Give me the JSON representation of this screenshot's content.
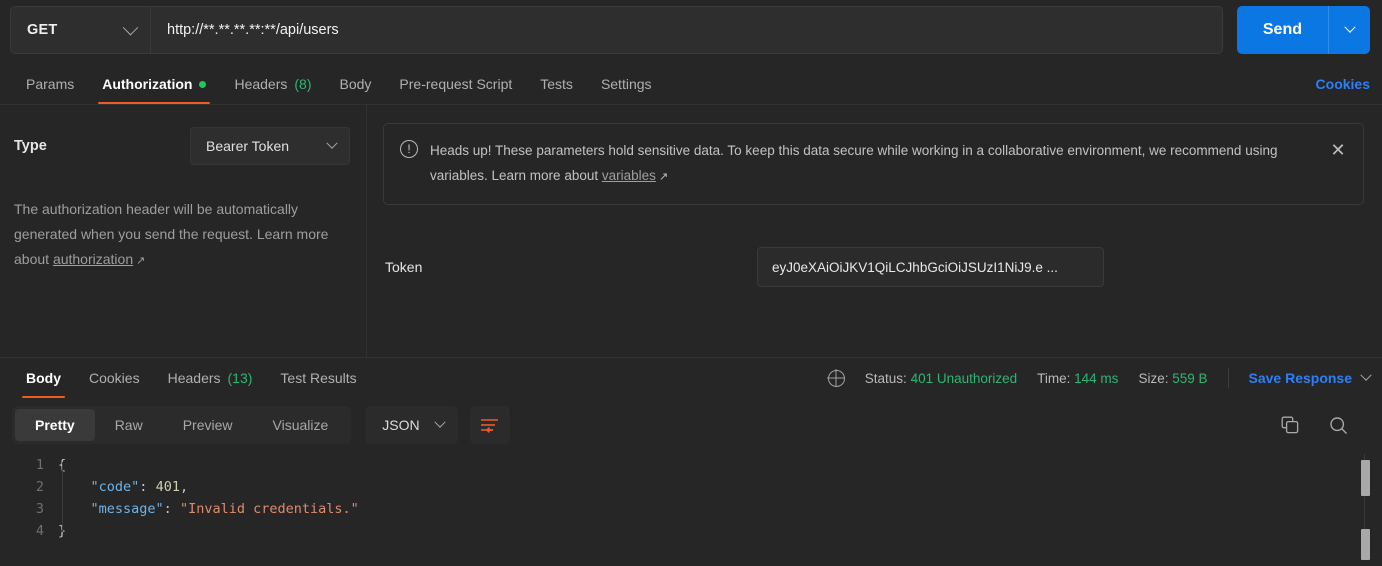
{
  "request": {
    "method": "GET",
    "url": "http://**.**.**.**:**/api/users",
    "send_label": "Send"
  },
  "request_tabs": [
    {
      "label": "Params",
      "active": false,
      "dot": false,
      "count": ""
    },
    {
      "label": "Authorization",
      "active": true,
      "dot": true,
      "count": ""
    },
    {
      "label": "Headers",
      "active": false,
      "dot": false,
      "count": "(8)"
    },
    {
      "label": "Body",
      "active": false,
      "dot": false,
      "count": ""
    },
    {
      "label": "Pre-request Script",
      "active": false,
      "dot": false,
      "count": ""
    },
    {
      "label": "Tests",
      "active": false,
      "dot": false,
      "count": ""
    },
    {
      "label": "Settings",
      "active": false,
      "dot": false,
      "count": ""
    }
  ],
  "cookies_link": "Cookies",
  "auth": {
    "type_label": "Type",
    "type_value": "Bearer Token",
    "description_before": "The authorization header will be automatically generated when you send the request. Learn more about ",
    "description_link": "authorization",
    "notice_before": "Heads up! These parameters hold sensitive data. To keep this data secure while working in a collaborative environment, we recommend using variables. Learn more about ",
    "notice_link": "variables",
    "token_label": "Token",
    "token_value": "eyJ0eXAiOiJKV1QiLCJhbGciOiJSUzI1NiJ9.e ..."
  },
  "response_tabs": [
    {
      "label": "Body",
      "active": true,
      "count": ""
    },
    {
      "label": "Cookies",
      "active": false,
      "count": ""
    },
    {
      "label": "Headers",
      "active": false,
      "count": "(13)"
    },
    {
      "label": "Test Results",
      "active": false,
      "count": ""
    }
  ],
  "response_meta": {
    "status_label": "Status:",
    "status_value": "401 Unauthorized",
    "time_label": "Time:",
    "time_value": "144 ms",
    "size_label": "Size:",
    "size_value": "559 B",
    "save_label": "Save Response"
  },
  "format_tabs": [
    {
      "label": "Pretty",
      "active": true
    },
    {
      "label": "Raw",
      "active": false
    },
    {
      "label": "Preview",
      "active": false
    },
    {
      "label": "Visualize",
      "active": false
    }
  ],
  "format_select": "JSON",
  "code": {
    "line_numbers": [
      "1",
      "2",
      "3",
      "4"
    ],
    "lines": [
      {
        "indent": "",
        "parts": [
          {
            "t": "{",
            "c": "k-brace"
          }
        ]
      },
      {
        "indent": "    ",
        "parts": [
          {
            "t": "\"code\"",
            "c": "k-key"
          },
          {
            "t": ": ",
            "c": "k-punc"
          },
          {
            "t": "401",
            "c": "k-num"
          },
          {
            "t": ",",
            "c": "k-punc"
          }
        ]
      },
      {
        "indent": "    ",
        "parts": [
          {
            "t": "\"message\"",
            "c": "k-key"
          },
          {
            "t": ": ",
            "c": "k-punc"
          },
          {
            "t": "\"Invalid credentials.\"",
            "c": "k-str"
          }
        ]
      },
      {
        "indent": "",
        "parts": [
          {
            "t": "}",
            "c": "k-brace"
          }
        ]
      }
    ]
  },
  "colors": {
    "accent_orange": "#ef5b25",
    "link_blue": "#2d7ff9",
    "send_blue": "#0b77e3",
    "status_green": "#2bb673"
  }
}
